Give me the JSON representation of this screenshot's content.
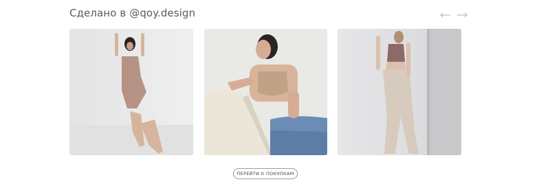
{
  "section": {
    "title": "Сделано в @qoy.design"
  },
  "carousel": {
    "prev_icon": "arrow-left-icon",
    "next_icon": "arrow-right-icon",
    "items": [
      {
        "image": "model-bodysuit-photo"
      },
      {
        "image": "model-bra-jeans-photo"
      },
      {
        "image": "model-top-trousers-photo"
      }
    ]
  },
  "cta": {
    "label": "ПЕРЕЙТИ К ПОКУПКАМ"
  },
  "colors": {
    "background": "#ffffff",
    "text": "#5a5a5a",
    "arrow": "#b0b0b0",
    "border": "#9a9a9a"
  }
}
